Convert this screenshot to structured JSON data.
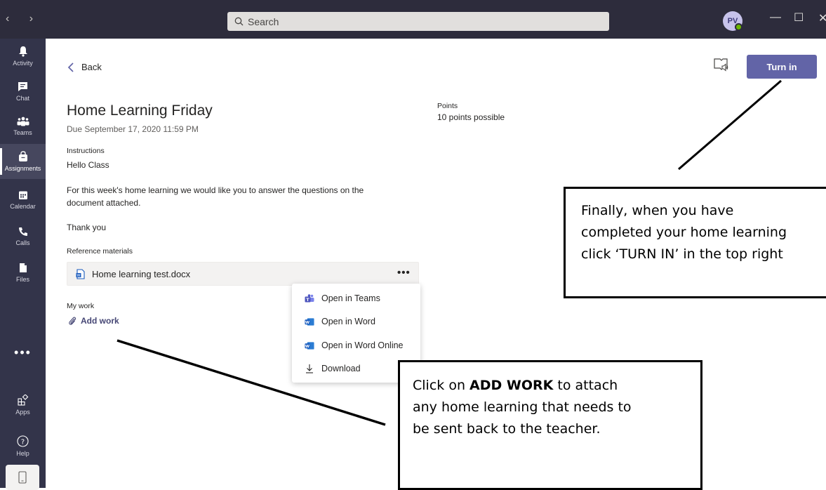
{
  "titlebar": {
    "search_placeholder": "Search",
    "avatar_initials": "PV"
  },
  "rail": {
    "items": [
      {
        "label": "Activity"
      },
      {
        "label": "Chat"
      },
      {
        "label": "Teams"
      },
      {
        "label": "Assignments"
      },
      {
        "label": "Calendar"
      },
      {
        "label": "Calls"
      },
      {
        "label": "Files"
      },
      {
        "label": "Apps"
      },
      {
        "label": "Help"
      }
    ],
    "more": "•••"
  },
  "header": {
    "back_label": "Back",
    "turn_in_label": "Turn in"
  },
  "assignment": {
    "title": "Home Learning Friday",
    "due": "Due September 17, 2020 11:59 PM",
    "points_label": "Points",
    "points_value": "10 points possible",
    "instructions_label": "Instructions",
    "instructions_lines": [
      "Hello Class",
      "For this week's home learning we would like you to answer the questions on the",
      "document attached.",
      "Thank you"
    ],
    "reference_label": "Reference materials",
    "attachment_name": "Home learning test.docx",
    "attachment_more": "•••",
    "my_work_label": "My work",
    "add_work_label": "Add work"
  },
  "context_menu": {
    "items": [
      {
        "label": "Open in Teams",
        "icon": "teams-icon"
      },
      {
        "label": "Open in Word",
        "icon": "word-icon"
      },
      {
        "label": "Open in Word Online",
        "icon": "word-icon"
      },
      {
        "label": "Download",
        "icon": "download-icon"
      }
    ]
  },
  "callouts": {
    "turn_in_lines": [
      "Finally, when you have",
      "completed your home learning",
      "click ‘TURN IN’ in the top right"
    ],
    "add_work_bold": "ADD WORK",
    "add_work_pre": "Click on ",
    "add_work_post": " to attach",
    "add_work_lines": [
      "any home learning that needs to",
      "be sent back to the teacher."
    ]
  },
  "colors": {
    "titlebar": "#2d2c3c",
    "rail": "#33344a",
    "accent": "#6264a7",
    "presence": "#6bb700",
    "word_blue": "#185abd"
  }
}
